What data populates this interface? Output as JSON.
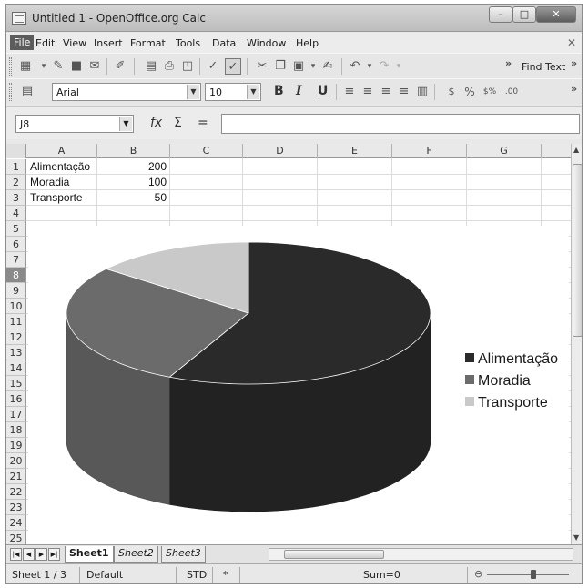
{
  "window": {
    "title": "Untitled 1 - OpenOffice.org Calc"
  },
  "menu": [
    "File",
    "Edit",
    "View",
    "Insert",
    "Format",
    "Tools",
    "Data",
    "Window",
    "Help"
  ],
  "toolbar": {
    "find_text": "Find Text"
  },
  "format": {
    "font_name": "Arial",
    "font_size": "10",
    "bold": "B",
    "italic": "I",
    "underline": "U"
  },
  "formula": {
    "cell_ref": "J8",
    "fx": "fx",
    "sum": "Σ",
    "equals": "=",
    "content": ""
  },
  "columns": [
    "A",
    "B",
    "C",
    "D",
    "E",
    "F",
    "G"
  ],
  "rows": [
    "1",
    "2",
    "3",
    "4",
    "5",
    "6",
    "7",
    "8",
    "9",
    "10",
    "11",
    "12",
    "13",
    "14",
    "15",
    "16",
    "17",
    "18",
    "19",
    "20",
    "21",
    "22",
    "23",
    "24",
    "25"
  ],
  "active_row": "8",
  "cells": [
    {
      "label": "Alimentação",
      "value": "200"
    },
    {
      "label": "Moradia",
      "value": "100"
    },
    {
      "label": "Transporte",
      "value": "50"
    }
  ],
  "chart_data": {
    "type": "pie",
    "categories": [
      "Alimentação",
      "Moradia",
      "Transporte"
    ],
    "values": [
      200,
      100,
      50
    ],
    "colors": [
      "#2a2a2a",
      "#6b6b6b",
      "#c9c9c9"
    ],
    "style": "3d-cylinder",
    "legend_position": "right"
  },
  "tabs": [
    {
      "label": "Sheet1",
      "active": true
    },
    {
      "label": "Sheet2",
      "active": false
    },
    {
      "label": "Sheet3",
      "active": false
    }
  ],
  "status": {
    "sheet": "Sheet 1 / 3",
    "style": "Default",
    "mode": "STD",
    "modified": "*",
    "sum": "Sum=0"
  }
}
